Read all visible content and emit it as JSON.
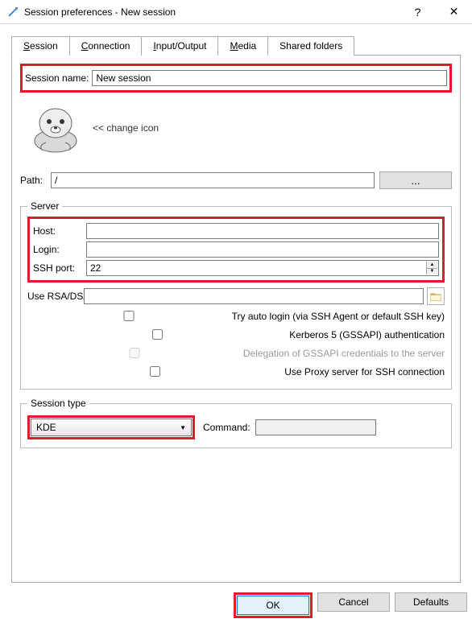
{
  "window": {
    "title": "Session preferences - New session",
    "help": "?",
    "close": "✕"
  },
  "tabs": {
    "session": "Session",
    "connection": "Connection",
    "io": "Input/Output",
    "media": "Media",
    "shared": "Shared folders"
  },
  "session_name": {
    "label": "Session name:",
    "value": "New session"
  },
  "change_icon": "<< change icon",
  "path": {
    "label": "Path:",
    "value": "/",
    "browse": "..."
  },
  "server": {
    "legend": "Server",
    "host_label": "Host:",
    "host_value": "",
    "login_label": "Login:",
    "login_value": "",
    "sshport_label": "SSH port:",
    "sshport_value": "22",
    "rsa_label": "Use RSA/DSA key for ssh connection:",
    "rsa_value": "",
    "auto_login": "Try auto login (via SSH Agent or default SSH key)",
    "kerberos": "Kerberos 5 (GSSAPI) authentication",
    "delegation": "Delegation of GSSAPI credentials to the server",
    "proxy": "Use Proxy server for SSH connection"
  },
  "session_type": {
    "legend": "Session type",
    "value": "KDE",
    "command_label": "Command:",
    "command_value": ""
  },
  "buttons": {
    "ok": "OK",
    "cancel": "Cancel",
    "defaults": "Defaults"
  }
}
